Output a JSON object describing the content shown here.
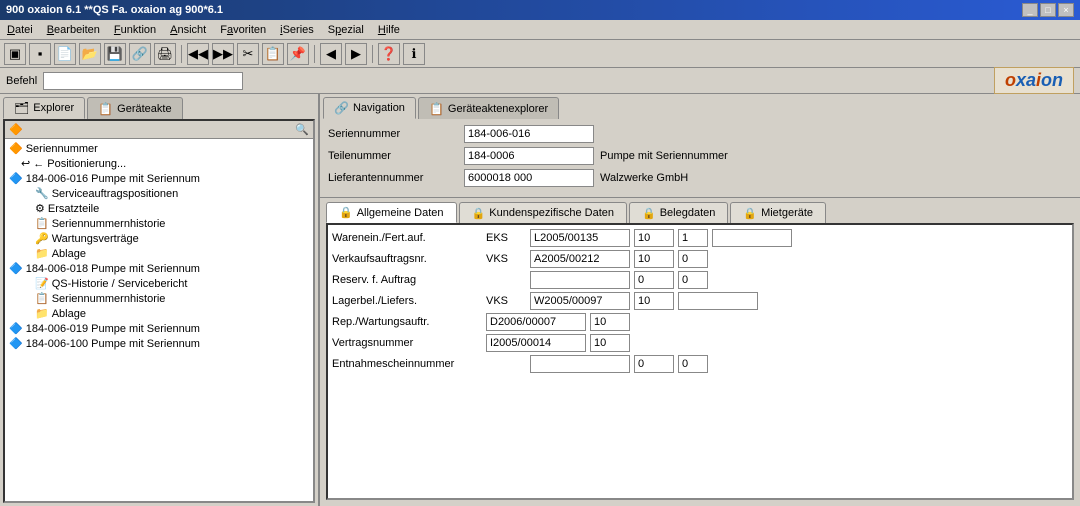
{
  "titlebar": {
    "title": "900 oxaion 6.1 **QS Fa. oxaion ag 900*6.1",
    "controls": [
      "_",
      "□",
      "×"
    ]
  },
  "menubar": {
    "items": [
      "Datei",
      "Bearbeiten",
      "Funktion",
      "Ansicht",
      "Favoriten",
      "iSeries",
      "Spezial",
      "Hilfe"
    ]
  },
  "commandbar": {
    "label": "Befehl",
    "placeholder": "",
    "logo": "oxaion"
  },
  "left_panel": {
    "tabs": [
      {
        "label": "Explorer",
        "active": true,
        "icon": "🗂"
      },
      {
        "label": "Geräteakte",
        "active": false,
        "icon": "📋"
      }
    ],
    "tree": {
      "items": [
        {
          "level": 0,
          "icon": "🔶",
          "text": "Seriennummer"
        },
        {
          "level": 1,
          "icon": "↩",
          "text": "← Positionierung..."
        },
        {
          "level": 0,
          "icon": "🔷",
          "text": "184-006-016  Pumpe mit Seriennum"
        },
        {
          "level": 1,
          "icon": "🔧",
          "text": "Serviceauftragspositionen"
        },
        {
          "level": 1,
          "icon": "⚙",
          "text": "Ersatzteile"
        },
        {
          "level": 1,
          "icon": "📋",
          "text": "Seriennummernhistorie"
        },
        {
          "level": 1,
          "icon": "🔑",
          "text": "Wartungsverträge"
        },
        {
          "level": 1,
          "icon": "📁",
          "text": "Ablage"
        },
        {
          "level": 0,
          "icon": "🔷",
          "text": "184-006-018  Pumpe mit Seriennum"
        },
        {
          "level": 1,
          "icon": "📝",
          "text": "QS-Historie / Servicebericht"
        },
        {
          "level": 1,
          "icon": "📋",
          "text": "Seriennummernhistorie"
        },
        {
          "level": 1,
          "icon": "📁",
          "text": "Ablage"
        },
        {
          "level": 0,
          "icon": "🔷",
          "text": "184-006-019  Pumpe mit Seriennum"
        },
        {
          "level": 0,
          "icon": "🔷",
          "text": "184-006-100  Pumpe mit Seriennum"
        }
      ]
    }
  },
  "right_panel": {
    "tabs": [
      {
        "label": "Navigation",
        "active": true,
        "icon": "🔗"
      },
      {
        "label": "Geräteaktenexplorer",
        "active": false,
        "icon": "📋"
      }
    ],
    "form": {
      "fields": [
        {
          "label": "Seriennummer",
          "value": "184-006-016",
          "extra": ""
        },
        {
          "label": "Teilenummer",
          "value": "184-0006",
          "extra": "Pumpe mit Seriennummer"
        },
        {
          "label": "Lieferantennummer",
          "value": "6000018 000",
          "extra": "Walzwerke GmbH"
        }
      ]
    },
    "inner_tabs": [
      {
        "label": "Allgemeine Daten",
        "active": true,
        "icon": "🔒"
      },
      {
        "label": "Kundenspezifische Daten",
        "active": false,
        "icon": "🔒"
      },
      {
        "label": "Belegdaten",
        "active": false,
        "icon": "🔒"
      },
      {
        "label": "Mietgeräte",
        "active": false,
        "icon": "🔒"
      }
    ],
    "grid_rows": [
      {
        "label": "Warenein./Fert.auf.",
        "code": "EKS",
        "value1": "L2005/00135",
        "num1": "10",
        "num2": "1",
        "extra": ""
      },
      {
        "label": "Verkaufsauftragsnr.",
        "code": "VKS",
        "value1": "A2005/00212",
        "num1": "10",
        "num2": "0",
        "extra": ""
      },
      {
        "label": "Reserv. f. Auftrag",
        "code": "",
        "value1": "",
        "num1": "0",
        "num2": "0",
        "extra": ""
      },
      {
        "label": "Lagerbel./Liefers.",
        "code": "VKS",
        "value1": "W2005/00097",
        "num1": "10",
        "num2": "",
        "extra": ""
      },
      {
        "label": "Rep./Wartungsauftr.",
        "code": "D2006/00007",
        "value1": "",
        "num1": "10",
        "num2": "",
        "extra": ""
      },
      {
        "label": "Vertragsnummer",
        "code": "I2005/00014",
        "value1": "",
        "num1": "10",
        "num2": "",
        "extra": ""
      },
      {
        "label": "Entnahmescheinnummer",
        "code": "",
        "value1": "",
        "num1": "0",
        "num2": "0",
        "extra": ""
      }
    ]
  }
}
